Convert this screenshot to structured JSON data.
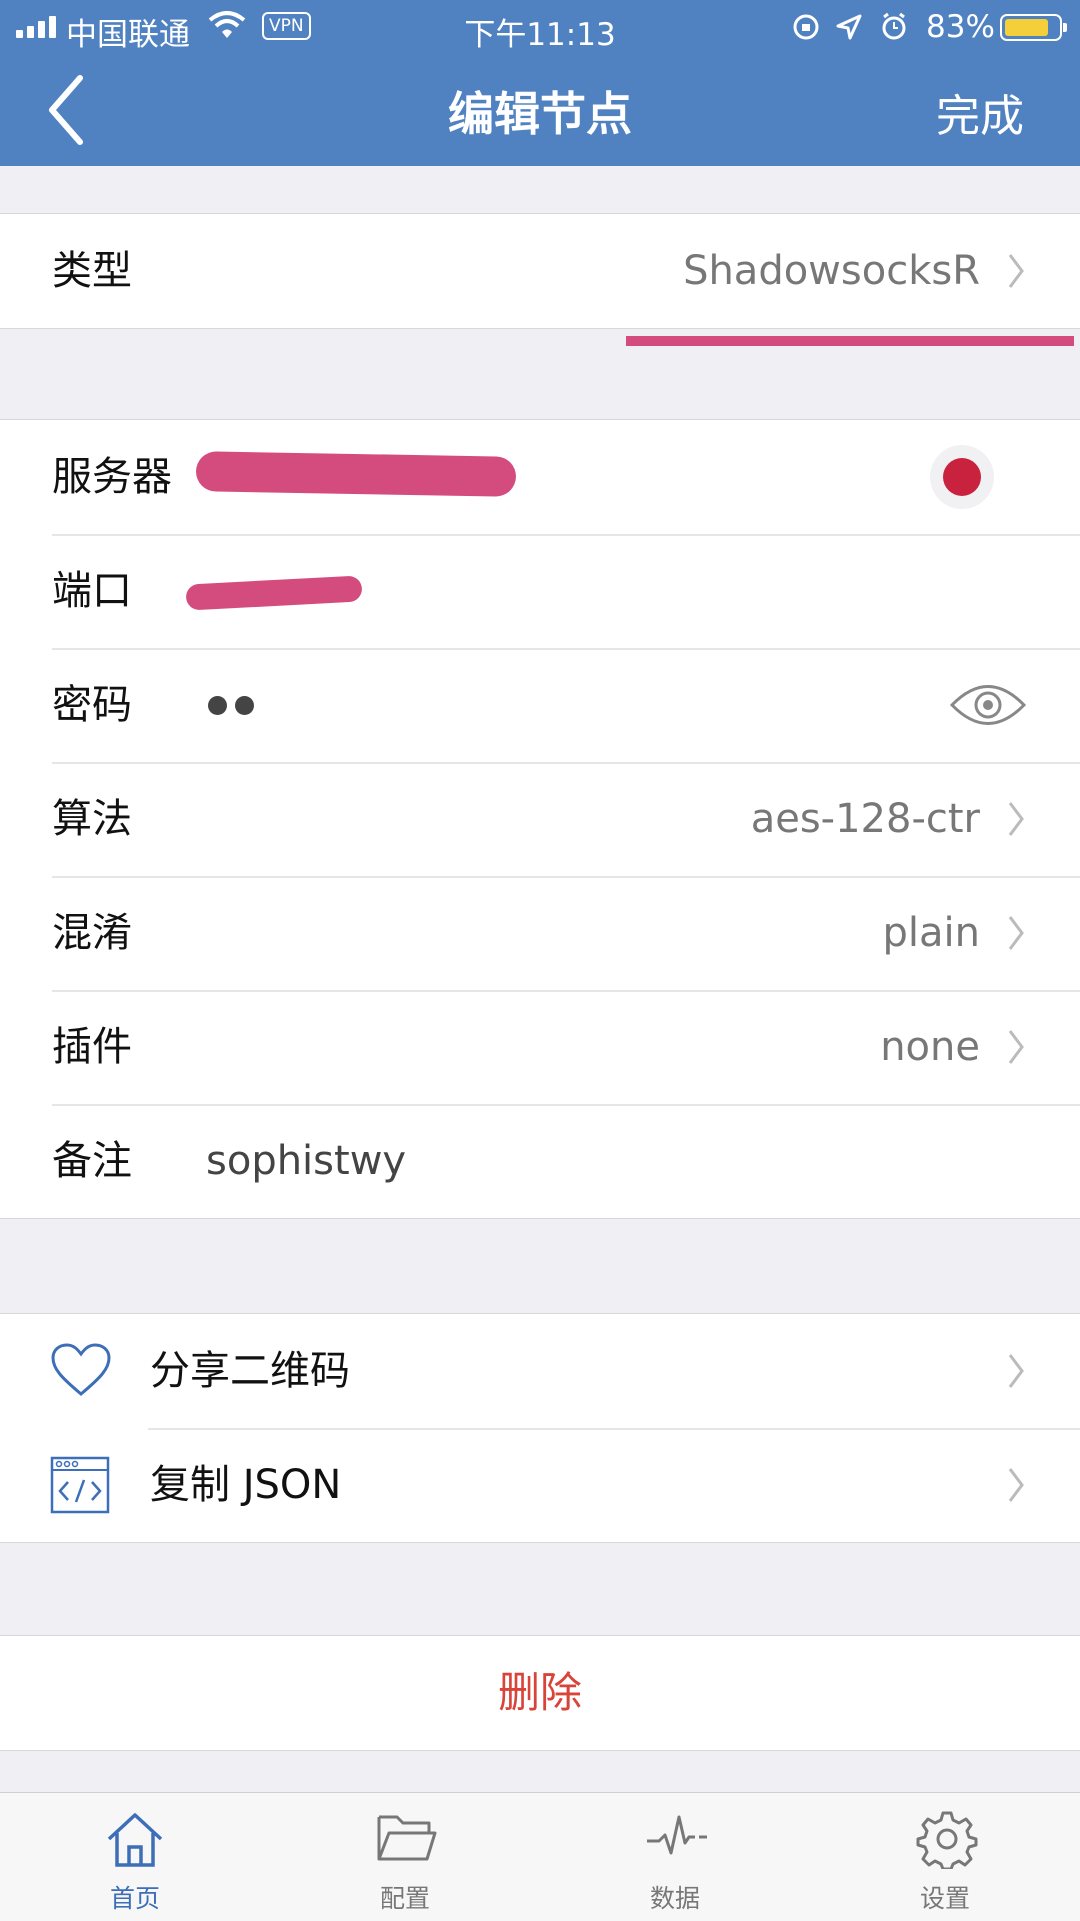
{
  "status_bar": {
    "carrier": "中国联通",
    "vpn": "VPN",
    "time": "下午11:13",
    "battery": "83%",
    "battery_level": 0.83
  },
  "nav": {
    "title": "编辑节点",
    "done": "完成",
    "back_icon": "chevron-left-icon"
  },
  "type_row": {
    "label": "类型",
    "value": "ShadowsocksR"
  },
  "fields": {
    "server": {
      "label": "服务器"
    },
    "port": {
      "label": "端口"
    },
    "password": {
      "label": "密码",
      "masked": "••"
    },
    "method": {
      "label": "算法",
      "value": "aes-128-ctr"
    },
    "obfs": {
      "label": "混淆",
      "value": "plain"
    },
    "plugin": {
      "label": "插件",
      "value": "none"
    },
    "remark": {
      "label": "备注",
      "value": "sophistwy"
    }
  },
  "actions": [
    {
      "label": "分享二维码",
      "icon": "heart-icon"
    },
    {
      "label": "复制 JSON",
      "icon": "code-window-icon"
    }
  ],
  "delete": "删除",
  "tabs": [
    {
      "label": "首页",
      "icon": "home-icon",
      "active": true
    },
    {
      "label": "配置",
      "icon": "folder-icon",
      "active": false
    },
    {
      "label": "数据",
      "icon": "pulse-icon",
      "active": false
    },
    {
      "label": "设置",
      "icon": "gear-icon",
      "active": false
    }
  ],
  "colors": {
    "nav": "#5082c2",
    "accent": "#3d6eb8",
    "delete": "#d9443a",
    "redaction": "#d44c7e",
    "status_dot": "#c8223e"
  }
}
